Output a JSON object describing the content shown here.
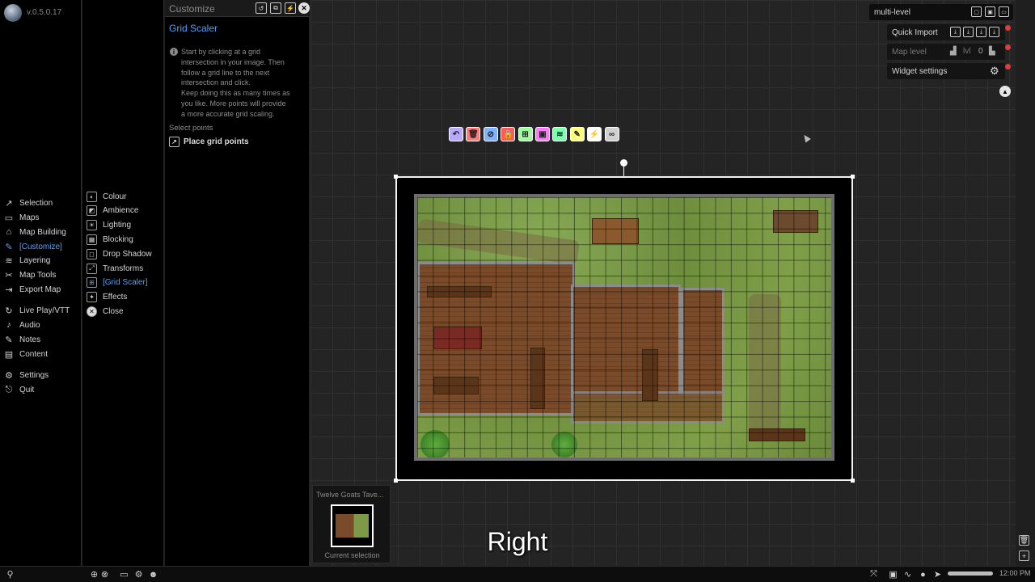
{
  "app": {
    "version": "v.0.5.0.17"
  },
  "nav": {
    "items": [
      {
        "label": "Selection",
        "icon": "selection-icon"
      },
      {
        "label": "Maps",
        "icon": "maps-icon"
      },
      {
        "label": "Map Building",
        "icon": "map-building-icon"
      },
      {
        "label": "[Customize]",
        "icon": "customize-icon",
        "active": true
      },
      {
        "label": "Layering",
        "icon": "layering-icon"
      },
      {
        "label": "Map Tools",
        "icon": "map-tools-icon"
      },
      {
        "label": "Export Map",
        "icon": "export-map-icon"
      },
      {
        "label": "Live Play/VTT",
        "icon": "live-play-icon"
      },
      {
        "label": "Audio",
        "icon": "audio-icon"
      },
      {
        "label": "Notes",
        "icon": "notes-icon"
      },
      {
        "label": "Content",
        "icon": "content-icon"
      },
      {
        "label": "Settings",
        "icon": "gear-icon"
      },
      {
        "label": "Quit",
        "icon": "quit-icon"
      }
    ]
  },
  "submenu": {
    "items": [
      {
        "label": "Colour"
      },
      {
        "label": "Ambience"
      },
      {
        "label": "Lighting"
      },
      {
        "label": "Blocking"
      },
      {
        "label": "Drop Shadow"
      },
      {
        "label": "Transforms"
      },
      {
        "label": "[Grid Scaler]",
        "active": true
      },
      {
        "label": "Effects"
      },
      {
        "label": "Close"
      }
    ]
  },
  "panel": {
    "title": "Customize",
    "section_title": "Grid Scaler",
    "info": "Start by clicking at a grid\nintersection in your image. Then\nfollow a grid line to the next\nintersection and click.\nKeep doing this as many times as\nyou like. More points will provide\na more accurate grid scaling.",
    "select_points_label": "Select points",
    "place_grid_label": "Place grid points"
  },
  "toolbar": {
    "tools": [
      {
        "name": "undo-tool",
        "color": "#b9a8ff",
        "glyph": "↶"
      },
      {
        "name": "delete-tool",
        "color": "#ff7a7a",
        "glyph": "🗑"
      },
      {
        "name": "hide-tool",
        "color": "#7fb2ff",
        "glyph": "⊘"
      },
      {
        "name": "lock-tool",
        "color": "#ff5a5a",
        "glyph": "🔒"
      },
      {
        "name": "group-tool",
        "color": "#9bff9b",
        "glyph": "⊞"
      },
      {
        "name": "image-tool",
        "color": "#ff7aff",
        "glyph": "▣"
      },
      {
        "name": "layers-tool",
        "color": "#7dffb0",
        "glyph": "≋"
      },
      {
        "name": "magic-wand-tool",
        "color": "#ffff7a",
        "glyph": "✎"
      },
      {
        "name": "lightning-tool",
        "color": "#ffffff",
        "glyph": "⚡"
      },
      {
        "name": "link-tool",
        "color": "#d0d0d0",
        "glyph": "∞"
      }
    ]
  },
  "widgets": {
    "multilevel_label": "multi-level",
    "quick_import_label": "Quick Import",
    "map_level_label": "Map level",
    "map_level_unit": "lvl",
    "map_level_value": "0",
    "widget_settings_label": "Widget settings"
  },
  "thumbnail": {
    "title": "Twelve Goats Tave...",
    "label": "Current selection"
  },
  "subtitle": "Right",
  "status": {
    "time": "12:00 PM"
  }
}
